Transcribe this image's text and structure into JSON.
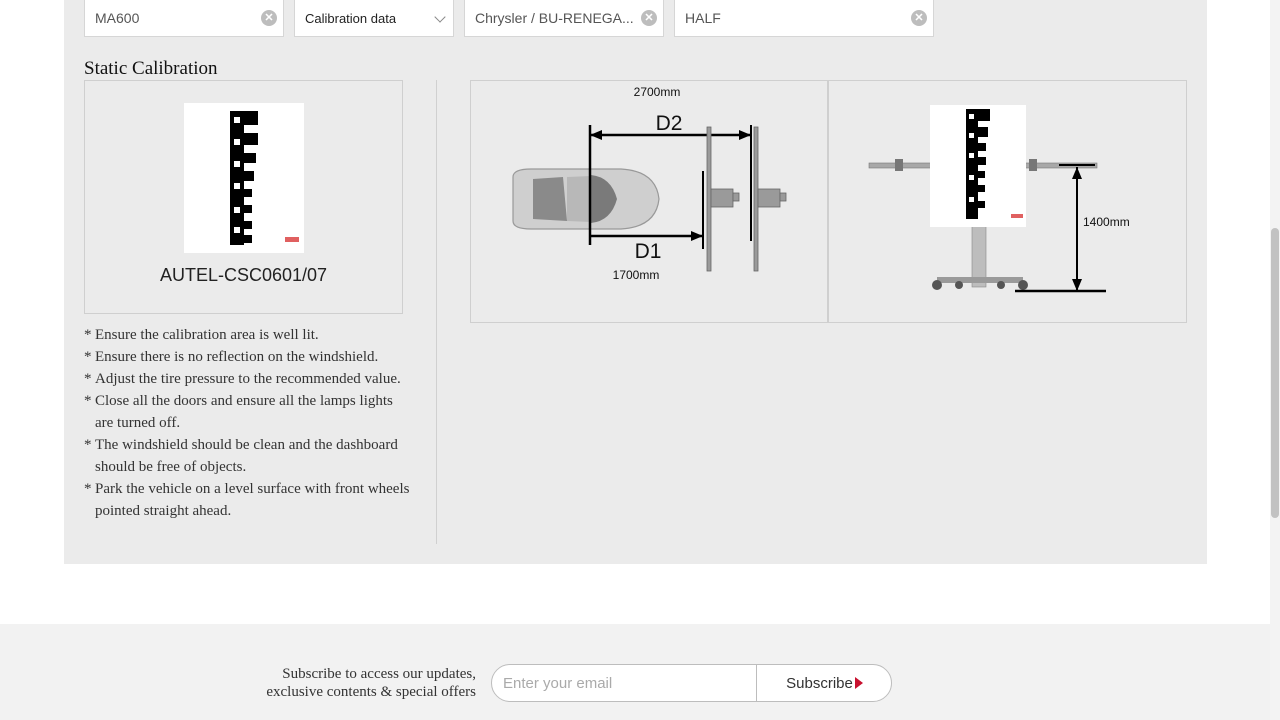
{
  "filters": {
    "product": "MA600",
    "data_type": "Calibration data",
    "vehicle": "Chrysler / BU-RENEGA...",
    "system": "HALF"
  },
  "section_title": "Static Calibration",
  "target": {
    "code": "AUTEL-CSC0601/07"
  },
  "notes": [
    "Ensure the calibration area is well lit.",
    "Ensure there is no reflection on the windshield.",
    "Adjust the tire pressure to the recommended value.",
    "Close all the doors and ensure all the lamps lights are turned off.",
    "The windshield should be clean and the dashboard should be free of objects.",
    "Park the vehicle on a level surface with front wheels pointed straight ahead."
  ],
  "diagram_top": {
    "d2_label": "D2",
    "d2_value": "2700mm",
    "d1_label": "D1",
    "d1_value": "1700mm"
  },
  "diagram_side": {
    "height_value": "1400mm"
  },
  "subscribe": {
    "text_line1": "Subscribe to access our updates,",
    "text_line2": "exclusive contents & special offers",
    "email_placeholder": "Enter your email",
    "button_label": "Subscribe"
  },
  "colors": {
    "panel_bg": "#ebebeb",
    "accent": "#c8102e",
    "footer_bg": "#f2f2f2"
  }
}
